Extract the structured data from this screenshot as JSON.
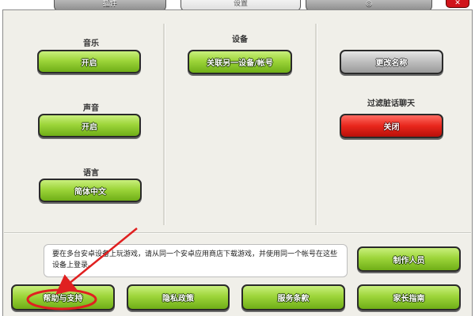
{
  "tabs": [
    {
      "label": "插件",
      "active": false
    },
    {
      "label": "设置",
      "active": true
    },
    {
      "label": "◎",
      "active": false
    }
  ],
  "close_label": "✕",
  "music": {
    "title": "音乐",
    "button": "开启"
  },
  "sound": {
    "title": "声音",
    "button": "开启"
  },
  "language": {
    "title": "语言",
    "button": "简体中文"
  },
  "device": {
    "title": "设备",
    "button": "关联另一设备/帐号"
  },
  "rename": {
    "button": "更改名称"
  },
  "filter": {
    "title": "过滤脏话聊天",
    "button": "关闭"
  },
  "notice": "要在多台安卓设备上玩游戏，请从同一个安卓应用商店下载游戏，并使用同一个帐号在这些设备上登录。",
  "credits": {
    "button": "制作人员"
  },
  "bottom": {
    "help": "帮助与支持",
    "privacy": "隐私政策",
    "terms": "服务条款",
    "parents": "家长指南"
  },
  "colors": {
    "green": "#9dd53a",
    "red": "#e8261c",
    "gray": "#bdbdbd",
    "annotation": "#e02020"
  }
}
